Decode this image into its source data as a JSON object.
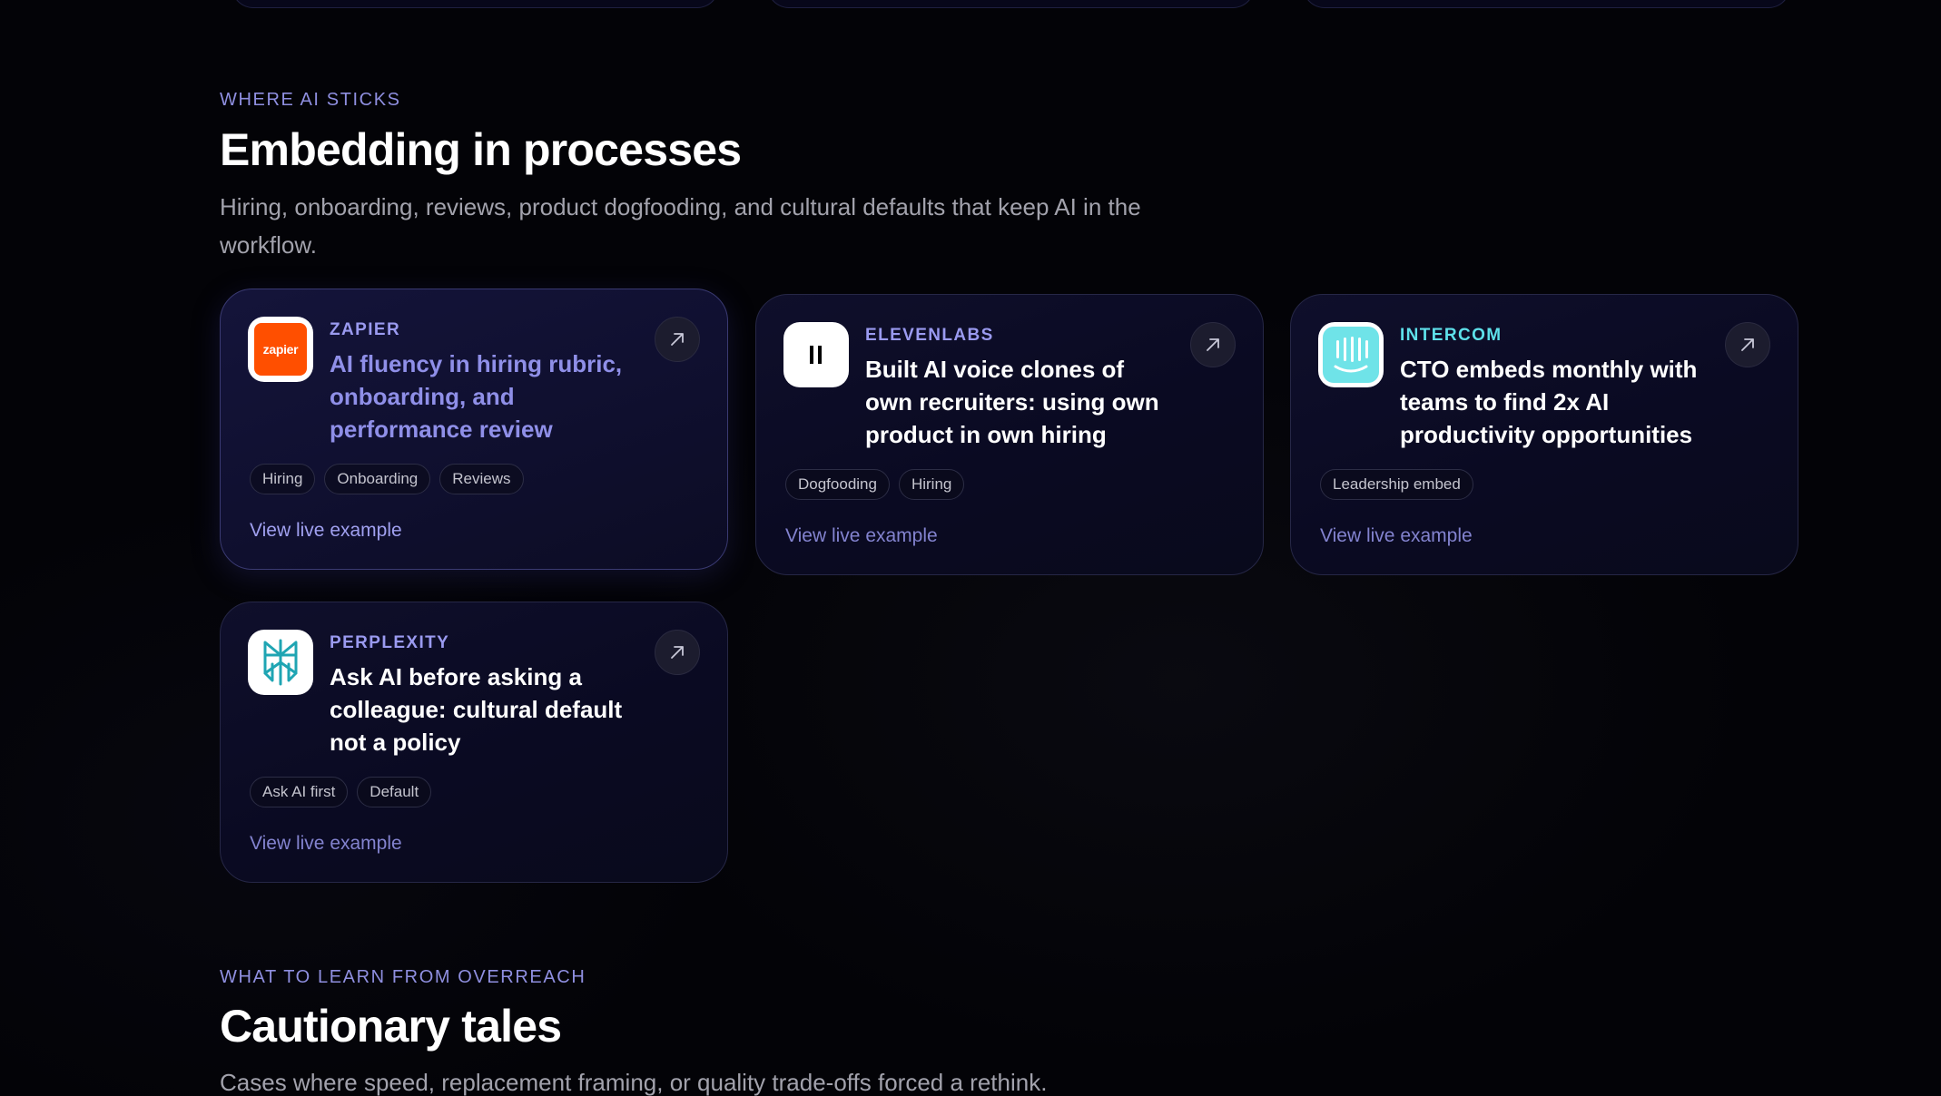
{
  "embedding": {
    "eyebrow": "WHERE AI STICKS",
    "title": "Embedding in processes",
    "description": "Hiring, onboarding, reviews, product dogfooding, and cultural defaults that keep AI in the workflow."
  },
  "cards": [
    {
      "company": "ZAPIER",
      "logo_text": "zapier",
      "headline": "AI fluency in hiring rubric, onboarding, and performance review",
      "tags": [
        "Hiring",
        "Onboarding",
        "Reviews"
      ],
      "link": "View live example",
      "company_color": "#9a9af0"
    },
    {
      "company": "ELEVENLABS",
      "headline": "Built AI voice clones of own recruiters: using own product in own hiring",
      "tags": [
        "Dogfooding",
        "Hiring"
      ],
      "link": "View live example",
      "company_color": "#9a9af0"
    },
    {
      "company": "INTERCOM",
      "headline": "CTO embeds monthly with teams to find 2x AI productivity opportunities",
      "tags": [
        "Leadership embed"
      ],
      "link": "View live example",
      "company_color": "#5ee0ea"
    },
    {
      "company": "PERPLEXITY",
      "headline": "Ask AI before asking a colleague: cultural default not a policy",
      "tags": [
        "Ask AI first",
        "Default"
      ],
      "link": "View live example",
      "company_color": "#9a9af0"
    }
  ],
  "cautionary": {
    "eyebrow": "WHAT TO LEARN FROM OVERREACH",
    "title": "Cautionary tales",
    "description": "Cases where speed, replacement framing, or quality trade-offs forced a rethink."
  }
}
